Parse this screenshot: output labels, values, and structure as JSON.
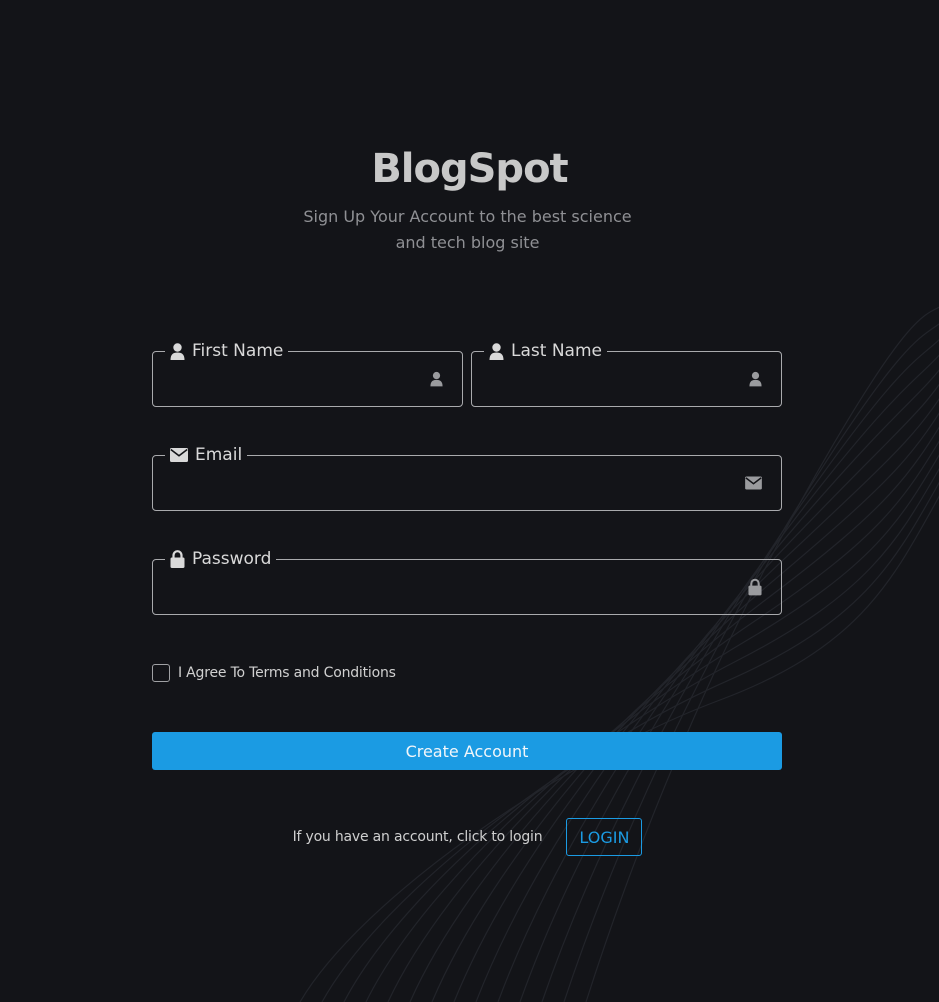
{
  "brand": {
    "title": "BlogSpot",
    "subtitle": "Sign Up Your Account to the best science and tech blog site"
  },
  "form": {
    "first_name": {
      "label": "First Name",
      "value": "",
      "icon": "user-icon"
    },
    "last_name": {
      "label": "Last Name",
      "value": "",
      "icon": "user-icon"
    },
    "email": {
      "label": "Email",
      "value": "",
      "icon": "envelope-icon"
    },
    "password": {
      "label": "Password",
      "value": "",
      "icon": "lock-icon"
    },
    "terms": {
      "label": "I Agree To Terms and Conditions",
      "checked": false
    },
    "submit_label": "Create Account"
  },
  "footer": {
    "prompt": "If you have an account, click to login",
    "login_label": "LOGIN"
  },
  "colors": {
    "background": "#131418",
    "accent": "#1b9be3",
    "border": "#a9aaad"
  }
}
